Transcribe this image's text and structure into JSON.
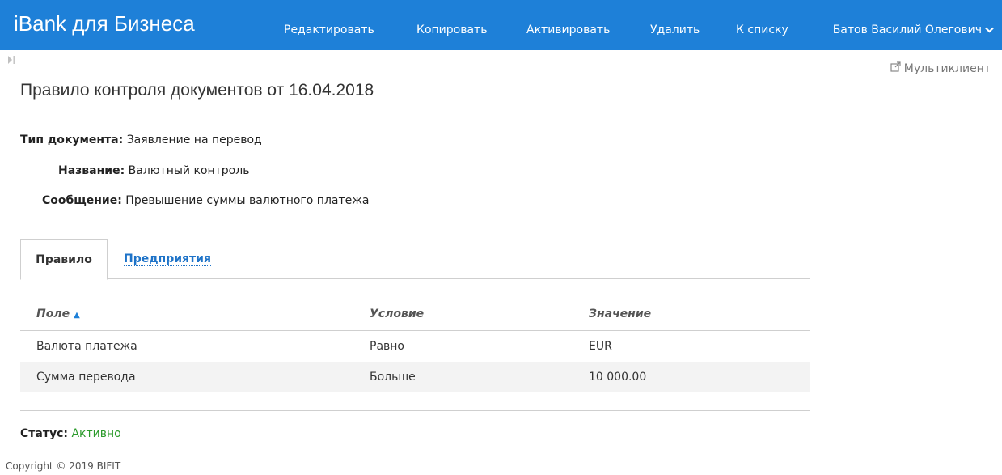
{
  "header": {
    "brand": "iBank для Бизнеса",
    "nav": [
      "Редактировать",
      "Копировать",
      "Активировать",
      "Удалить",
      "К списку"
    ],
    "user": "Батов Василий Олегович",
    "user_icon": "chevron-down-icon",
    "color": "#1e80d8"
  },
  "sidebar": {
    "toggle_icon": "collapse-sidebar-icon"
  },
  "multiclient": {
    "label": "Мультиклиент",
    "icon": "external-link-icon"
  },
  "page": {
    "title": "Правило контроля документов от 16.04.2018"
  },
  "fields": [
    {
      "label": "Тип документа:",
      "value": "Заявление на перевод"
    },
    {
      "label": "Название:",
      "value": "Валютный контроль"
    },
    {
      "label": "Сообщение:",
      "value": "Превышение суммы валютного платежа"
    }
  ],
  "tabs": {
    "active": "Правило",
    "other": "Предприятия"
  },
  "table": {
    "headers": [
      "Поле",
      "Условие",
      "Значение"
    ],
    "sort_icon": "sort-ascending-icon",
    "rows": [
      [
        "Валюта платежа",
        "Равно",
        "EUR"
      ],
      [
        "Сумма перевода",
        "Больше",
        "10 000.00"
      ]
    ]
  },
  "status": {
    "label": "Статус:",
    "value": "Активно",
    "color": "#2a9a2a"
  },
  "footer": {
    "copyright": "Copyright © 2019 BIFIT"
  }
}
